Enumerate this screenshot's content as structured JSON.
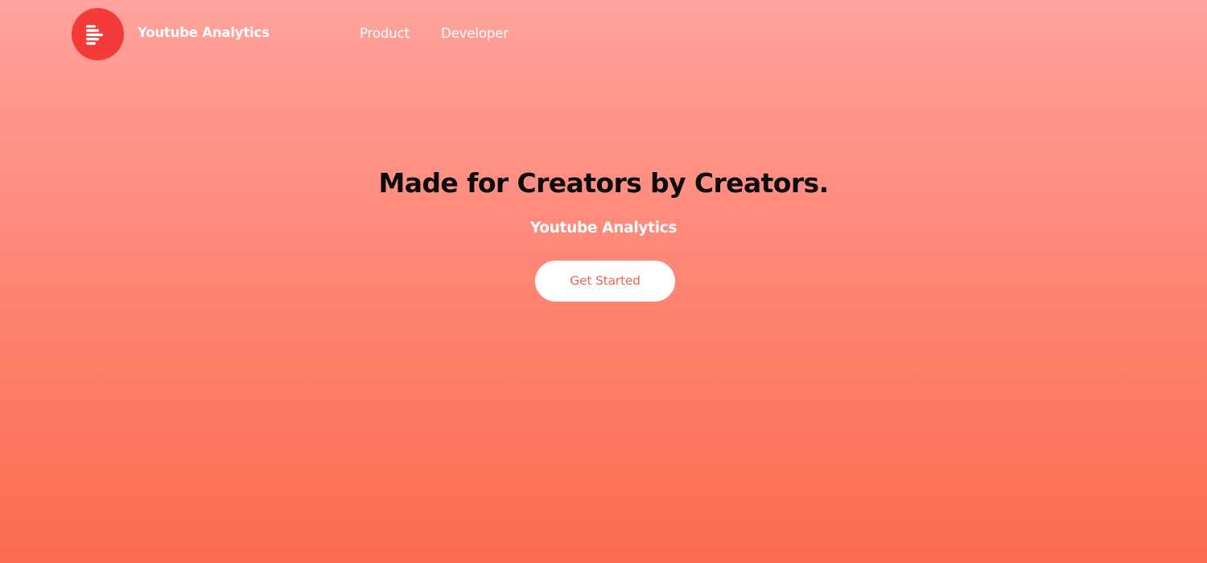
{
  "header": {
    "brand_name": "Youtube Analytics",
    "logo_icon": "bars-logo-icon",
    "nav": [
      {
        "label": "Product"
      },
      {
        "label": "Developer"
      }
    ]
  },
  "hero": {
    "title": "Made for Creators by Creators.",
    "subtitle": "Youtube Analytics",
    "cta_label": "Get Started"
  },
  "colors": {
    "background_top": "#ffa39d",
    "background_bottom": "#fb6b52",
    "logo_circle": "#f53a3a",
    "cta_text": "#f2654f",
    "title_text": "#0b0b0b"
  }
}
